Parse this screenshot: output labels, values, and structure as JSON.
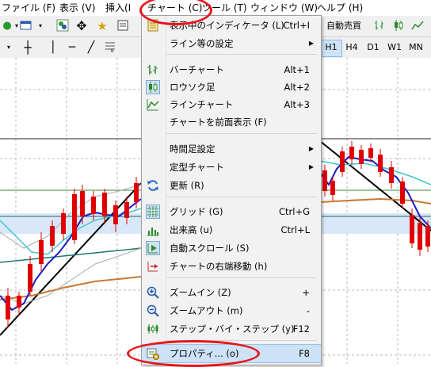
{
  "menubar": {
    "items": [
      {
        "label": "ファイル (F)"
      },
      {
        "label": "表示 (V)"
      },
      {
        "label": "挿入(I"
      },
      {
        "label": "チャート (C)"
      },
      {
        "label": "ツール (T)"
      },
      {
        "label": "ウィンドウ (W)"
      },
      {
        "label": "ヘルプ (H)"
      }
    ]
  },
  "toolbar": {
    "auto_trade_label": "自動売買",
    "timeframes": [
      "H1",
      "H4",
      "D1",
      "W1",
      "MN"
    ],
    "active_timeframe": "H1"
  },
  "menu": {
    "items": [
      {
        "label": "表示中のインディケータ (L)",
        "shortcut": "Ctrl+I",
        "icon": "indicator-list-icon",
        "submenu": false
      },
      {
        "label": "ライン等の設定",
        "shortcut": "",
        "icon": "",
        "submenu": true
      },
      {
        "label": "バーチャート",
        "shortcut": "Alt+1",
        "icon": "bar-chart-icon",
        "submenu": false
      },
      {
        "label": "ロウソク足",
        "shortcut": "Alt+2",
        "icon": "candlestick-icon",
        "submenu": false
      },
      {
        "label": "ラインチャート",
        "shortcut": "Alt+3",
        "icon": "line-chart-icon",
        "submenu": false
      },
      {
        "label": "チャートを前面表示 (F)",
        "shortcut": "",
        "icon": "",
        "submenu": false
      },
      {
        "label": "時間足設定",
        "shortcut": "",
        "icon": "",
        "submenu": true
      },
      {
        "label": "定型チャート",
        "shortcut": "",
        "icon": "",
        "submenu": true
      },
      {
        "label": "更新 (R)",
        "shortcut": "",
        "icon": "refresh-icon",
        "submenu": false
      },
      {
        "label": "グリッド (G)",
        "shortcut": "Ctrl+G",
        "icon": "grid-icon",
        "submenu": false
      },
      {
        "label": "出来高 (u)",
        "shortcut": "Ctrl+L",
        "icon": "volume-icon",
        "submenu": false
      },
      {
        "label": "自動スクロール (S)",
        "shortcut": "",
        "icon": "auto-scroll-icon",
        "submenu": false
      },
      {
        "label": "チャートの右端移動 (h)",
        "shortcut": "",
        "icon": "chart-shift-icon",
        "submenu": false
      },
      {
        "label": "ズームイン (Z)",
        "shortcut": "+",
        "icon": "zoom-in-icon",
        "submenu": false
      },
      {
        "label": "ズームアウト (m)",
        "shortcut": "-",
        "icon": "zoom-out-icon",
        "submenu": false
      },
      {
        "label": "ステップ・バイ・ステップ (y)",
        "shortcut": "F12",
        "icon": "step-by-step-icon",
        "submenu": false
      },
      {
        "label": "プロパティ... (o)",
        "shortcut": "F8",
        "icon": "properties-icon",
        "submenu": false,
        "highlighted": true
      }
    ]
  },
  "colors": {
    "highlight_ring": "#e8141a",
    "menu_highlight": "#cde2f6",
    "bull_candle": "#1a1a1a",
    "bear_candle": "#e00000",
    "ma_blue": "#1c1cc8",
    "ma_cyan": "#3cc8c8",
    "ma_teal": "#1a7a6a",
    "ma_orange": "#c87832"
  }
}
